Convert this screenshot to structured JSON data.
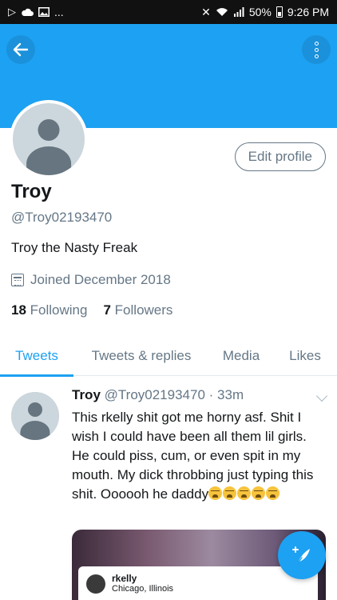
{
  "status_bar": {
    "left_glyph": "▷",
    "ellipsis": "...",
    "signal_glyph": "✕",
    "battery_pct": "50%",
    "time": "9:26 PM"
  },
  "header": {
    "back_icon": "arrow-left-icon",
    "menu_icon": "kebab-menu-icon",
    "banner_color": "#1da1f2"
  },
  "profile": {
    "edit_label": "Edit profile",
    "name": "Troy",
    "handle": "@Troy02193470",
    "bio": "Troy the Nasty Freak",
    "joined": "Joined December 2018",
    "following_count": "18",
    "following_label": "Following",
    "followers_count": "7",
    "followers_label": "Followers"
  },
  "tabs": [
    {
      "label": "Tweets",
      "active": true
    },
    {
      "label": "Tweets & replies",
      "active": false
    },
    {
      "label": "Media",
      "active": false
    },
    {
      "label": "Likes",
      "active": false
    }
  ],
  "tweet": {
    "name": "Troy",
    "handle": "@Troy02193470",
    "separator": "·",
    "time": "33m",
    "text": "This rkelly shit got me horny asf. Shit I wish I could have been all them lil girls. He could piss, cum, or even spit in my mouth. My dick throbbing just typing this shit. Oooooh he daddy",
    "emoji_count": 5,
    "embed_name": "rkelly",
    "embed_location": "Chicago, Illinois"
  },
  "fab": {
    "icon": "compose-feather-icon"
  },
  "colors": {
    "accent": "#1da1f2",
    "muted": "#657786",
    "text": "#14171a"
  }
}
